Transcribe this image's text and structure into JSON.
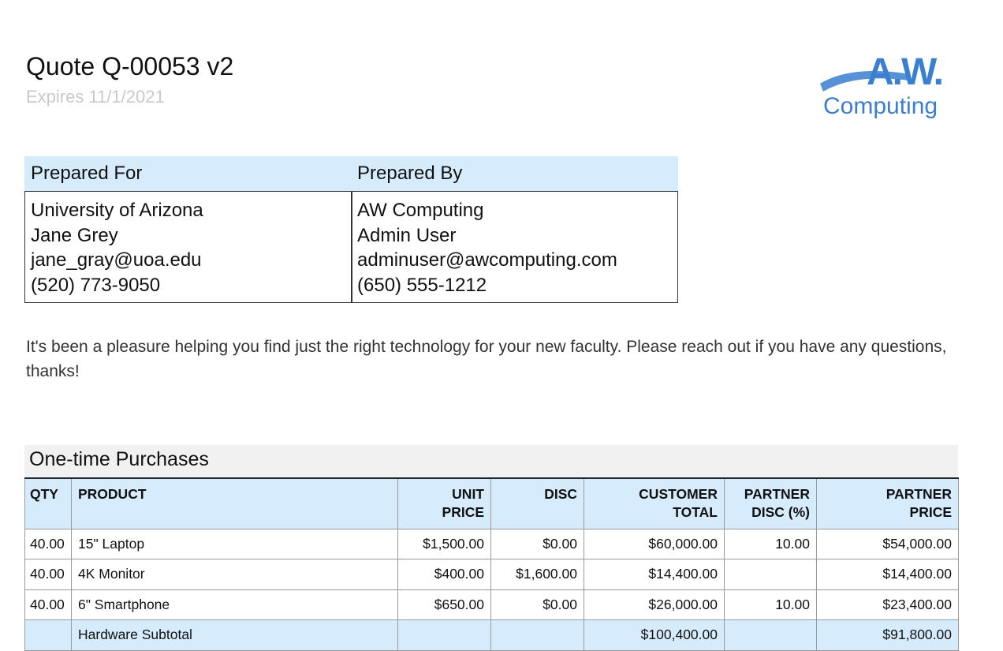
{
  "header": {
    "title": "Quote Q-00053 v2",
    "expires": "Expires 11/1/2021"
  },
  "logo": {
    "line1": "A.W.",
    "line2": "Computing",
    "color": "#3a7fd0"
  },
  "prepared": {
    "for_label": "Prepared For",
    "by_label": "Prepared By",
    "for": {
      "org": "University of Arizona",
      "name": "Jane Grey",
      "email": "jane_gray@uoa.edu",
      "phone": "(520) 773-9050"
    },
    "by": {
      "org": "AW Computing",
      "name": "Admin User",
      "email": "adminuser@awcomputing.com",
      "phone": "(650) 555-1212"
    }
  },
  "message": "It's been a pleasure helping you find just the right technology for your new faculty. Please reach out if you have any questions, thanks!",
  "one_time": {
    "title": "One-time Purchases",
    "columns": {
      "qty": "QTY",
      "product": "PRODUCT",
      "unit_price_1": "UNIT",
      "unit_price_2": "PRICE",
      "disc": "DISC",
      "customer_total_1": "CUSTOMER",
      "customer_total_2": "TOTAL",
      "partner_disc_1": "PARTNER",
      "partner_disc_2": "DISC (%)",
      "partner_price_1": "PARTNER",
      "partner_price_2": "PRICE"
    },
    "rows": [
      {
        "qty": "40.00",
        "product": "15\" Laptop",
        "unit_price": "$1,500.00",
        "disc": "$0.00",
        "customer_total": "$60,000.00",
        "partner_disc": "10.00",
        "partner_price": "$54,000.00"
      },
      {
        "qty": "40.00",
        "product": "4K Monitor",
        "unit_price": "$400.00",
        "disc": "$1,600.00",
        "customer_total": "$14,400.00",
        "partner_disc": "",
        "partner_price": "$14,400.00"
      },
      {
        "qty": "40.00",
        "product": "6\" Smartphone",
        "unit_price": "$650.00",
        "disc": "$0.00",
        "customer_total": "$26,000.00",
        "partner_disc": "10.00",
        "partner_price": "$23,400.00"
      }
    ],
    "subtotal": {
      "label": "Hardware Subtotal",
      "customer_total": "$100,400.00",
      "partner_price": "$91,800.00"
    }
  }
}
